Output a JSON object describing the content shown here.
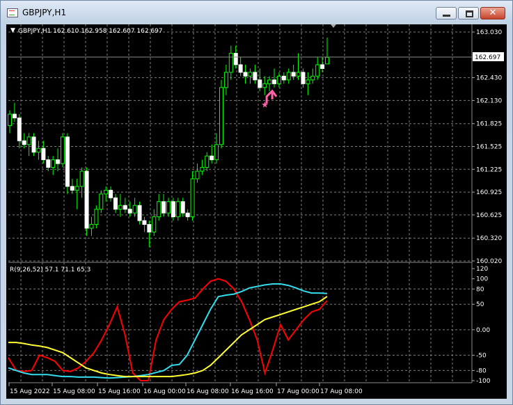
{
  "window": {
    "title": "GBPJPY,H1",
    "icon": "chart-window-icon",
    "buttons": {
      "minimize": "minimize-icon",
      "maximize": "maximize-icon",
      "close": "close-icon",
      "close_glyph": "✕"
    }
  },
  "colors": {
    "background": "#000000",
    "grid": "#7f7f7f",
    "bull_candle": "#00ff00",
    "bear_candle": "#ffffff",
    "osc_red": "#ff0000",
    "osc_cyan": "#33ddee",
    "osc_yellow": "#ffff33",
    "arrow": "#ff66aa"
  },
  "price_panel": {
    "header": "GBPJPY,H1  162.610 162.958 162.607 162.697",
    "current_price_label": "162.697",
    "y_ticks": [
      "163.030",
      "162.430",
      "162.130",
      "161.825",
      "161.525",
      "161.225",
      "160.925",
      "160.625",
      "160.320",
      "160.020"
    ]
  },
  "indicator_panel": {
    "header": "R(9,26,52) 57.1 71.1 65.3",
    "y_ticks": [
      "120",
      "100",
      "80",
      "50",
      "0.00",
      "-50",
      "-80",
      "-100"
    ]
  },
  "x_axis": {
    "labels": [
      "15 Aug 2022",
      "15 Aug 08:00",
      "15 Aug 16:00",
      "16 Aug 00:00",
      "16 Aug 08:00",
      "16 Aug 16:00",
      "17 Aug 00:00",
      "17 Aug 08:00"
    ]
  },
  "chart_data": [
    {
      "type": "candlestick",
      "symbol": "GBPJPY",
      "timeframe": "H1",
      "ylim": [
        160.02,
        163.03
      ],
      "last": {
        "open": 162.61,
        "high": 162.958,
        "low": 162.607,
        "close": 162.697
      },
      "candles": [
        [
          161.8,
          162.0,
          161.7,
          161.95
        ],
        [
          161.95,
          162.1,
          161.85,
          161.9
        ],
        [
          161.9,
          161.95,
          161.5,
          161.6
        ],
        [
          161.6,
          161.7,
          161.5,
          161.55
        ],
        [
          161.55,
          161.7,
          161.4,
          161.65
        ],
        [
          161.65,
          161.7,
          161.4,
          161.45
        ],
        [
          161.45,
          161.6,
          161.35,
          161.5
        ],
        [
          161.5,
          161.6,
          161.3,
          161.35
        ],
        [
          161.35,
          161.4,
          161.2,
          161.25
        ],
        [
          161.25,
          161.4,
          161.15,
          161.35
        ],
        [
          161.35,
          161.5,
          161.2,
          161.3
        ],
        [
          161.3,
          161.7,
          161.25,
          161.65
        ],
        [
          161.65,
          161.7,
          160.9,
          161.0
        ],
        [
          161.0,
          161.1,
          160.9,
          160.95
        ],
        [
          160.95,
          161.1,
          160.7,
          161.0
        ],
        [
          161.0,
          161.25,
          160.85,
          161.2
        ],
        [
          161.2,
          161.25,
          160.35,
          160.45
        ],
        [
          160.45,
          160.6,
          160.35,
          160.5
        ],
        [
          160.5,
          160.75,
          160.45,
          160.7
        ],
        [
          160.7,
          160.95,
          160.65,
          160.9
        ],
        [
          160.9,
          161.0,
          160.8,
          160.95
        ],
        [
          160.95,
          161.0,
          160.8,
          160.85
        ],
        [
          160.85,
          160.9,
          160.65,
          160.7
        ],
        [
          160.7,
          160.9,
          160.6,
          160.75
        ],
        [
          160.75,
          160.85,
          160.65,
          160.7
        ],
        [
          160.7,
          160.8,
          160.6,
          160.65
        ],
        [
          160.65,
          160.85,
          160.6,
          160.75
        ],
        [
          160.75,
          160.8,
          160.5,
          160.55
        ],
        [
          160.55,
          160.6,
          160.4,
          160.5
        ],
        [
          160.5,
          160.55,
          160.2,
          160.4
        ],
        [
          160.4,
          160.7,
          160.35,
          160.6
        ],
        [
          160.6,
          160.9,
          160.55,
          160.8
        ],
        [
          160.8,
          160.9,
          160.6,
          160.65
        ],
        [
          160.65,
          160.85,
          160.6,
          160.8
        ],
        [
          160.8,
          160.85,
          160.55,
          160.6
        ],
        [
          160.6,
          160.85,
          160.55,
          160.8
        ],
        [
          160.8,
          160.85,
          160.6,
          160.65
        ],
        [
          160.65,
          160.7,
          160.55,
          160.6
        ],
        [
          160.6,
          161.2,
          160.55,
          161.1
        ],
        [
          161.1,
          161.3,
          161.05,
          161.2
        ],
        [
          161.2,
          161.35,
          161.15,
          161.25
        ],
        [
          161.25,
          161.45,
          161.2,
          161.4
        ],
        [
          161.4,
          161.55,
          161.3,
          161.35
        ],
        [
          161.35,
          161.7,
          161.3,
          161.55
        ],
        [
          161.55,
          162.4,
          161.5,
          162.3
        ],
        [
          162.3,
          162.6,
          162.2,
          162.5
        ],
        [
          162.5,
          162.85,
          162.4,
          162.75
        ],
        [
          162.75,
          162.85,
          162.55,
          162.6
        ],
        [
          162.6,
          162.7,
          162.45,
          162.5
        ],
        [
          162.5,
          162.6,
          162.35,
          162.45
        ],
        [
          162.45,
          162.55,
          162.35,
          162.5
        ],
        [
          162.5,
          162.6,
          162.35,
          162.4
        ],
        [
          162.4,
          162.55,
          162.25,
          162.3
        ],
        [
          162.3,
          162.45,
          162.2,
          162.35
        ],
        [
          162.35,
          162.45,
          162.25,
          162.4
        ],
        [
          162.4,
          162.55,
          162.3,
          162.35
        ],
        [
          162.35,
          162.5,
          162.3,
          162.45
        ],
        [
          162.45,
          162.5,
          162.35,
          162.4
        ],
        [
          162.4,
          162.55,
          162.35,
          162.5
        ],
        [
          162.5,
          162.6,
          162.4,
          162.45
        ],
        [
          162.45,
          162.75,
          162.4,
          162.5
        ],
        [
          162.5,
          162.55,
          162.3,
          162.35
        ],
        [
          162.35,
          162.5,
          162.2,
          162.4
        ],
        [
          162.4,
          162.55,
          162.35,
          162.45
        ],
        [
          162.45,
          162.7,
          162.4,
          162.6
        ],
        [
          162.6,
          162.7,
          162.5,
          162.55
        ],
        [
          162.61,
          162.958,
          162.607,
          162.697
        ]
      ],
      "arrow_signal": "up"
    },
    {
      "type": "line",
      "name": "R(9,26,52)",
      "ylim": [
        -100,
        120
      ],
      "current": [
        57.1,
        71.1,
        65.3
      ],
      "series": [
        {
          "values": [
            -55,
            -80,
            -82,
            -80,
            -50,
            -55,
            -62,
            -80,
            -82,
            -75,
            -62,
            -45,
            -20,
            10,
            45,
            -10,
            -85,
            -100,
            -100,
            -20,
            20,
            40,
            55,
            58,
            62,
            80,
            95,
            100,
            95,
            80,
            55,
            20,
            -20,
            -85,
            -40,
            10,
            -20,
            0,
            20,
            35,
            40,
            57.1
          ]
        },
        {
          "values": [
            -75,
            -80,
            -85,
            -88,
            -88,
            -88,
            -90,
            -92,
            -92,
            -93,
            -93,
            -93,
            -94,
            -95,
            -94,
            -93,
            -92,
            -90,
            -88,
            -84,
            -80,
            -70,
            -68,
            -50,
            -20,
            10,
            40,
            65,
            68,
            70,
            75,
            82,
            85,
            88,
            90,
            90,
            87,
            82,
            76,
            72,
            72,
            71.1
          ]
        },
        {
          "values": [
            -25,
            -25,
            -27,
            -30,
            -32,
            -35,
            -40,
            -45,
            -55,
            -65,
            -75,
            -80,
            -85,
            -88,
            -90,
            -92,
            -92,
            -92,
            -92,
            -92,
            -92,
            -92,
            -90,
            -88,
            -85,
            -80,
            -70,
            -55,
            -40,
            -25,
            -10,
            0,
            10,
            20,
            25,
            30,
            35,
            40,
            45,
            50,
            55,
            65.3
          ]
        }
      ]
    }
  ]
}
